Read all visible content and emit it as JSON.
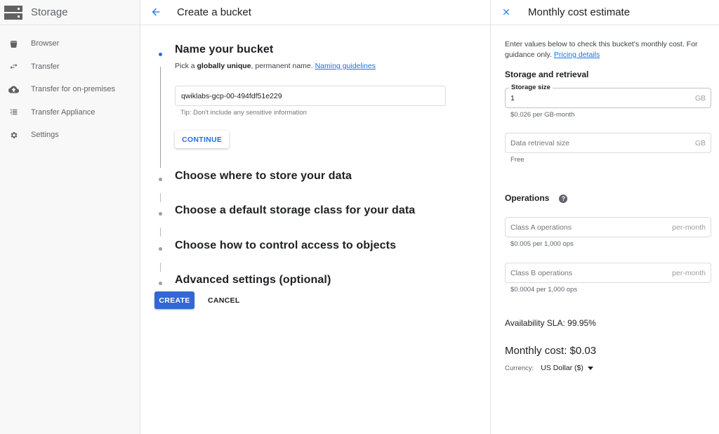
{
  "sidebar": {
    "title": "Storage",
    "items": [
      {
        "label": "Browser",
        "icon": "bucket-icon"
      },
      {
        "label": "Transfer",
        "icon": "transfer-arrows-icon"
      },
      {
        "label": "Transfer for on-premises",
        "icon": "cloud-upload-icon"
      },
      {
        "label": "Transfer Appliance",
        "icon": "appliance-list-icon"
      },
      {
        "label": "Settings",
        "icon": "gear-icon"
      }
    ]
  },
  "main": {
    "title": "Create a bucket",
    "steps": [
      {
        "title": "Name your bucket",
        "desc_prefix": "Pick a ",
        "desc_bold": "globally unique",
        "desc_suffix": ", permanent name. ",
        "link": "Naming guidelines",
        "input_value": "qwiklabs-gcp-00-494fdf51e229",
        "tip": "Tip: Don't include any sensitive information",
        "continue_label": "CONTINUE",
        "active": true
      },
      {
        "title": "Choose where to store your data"
      },
      {
        "title": "Choose a default storage class for your data"
      },
      {
        "title": "Choose how to control access to objects"
      },
      {
        "title": "Advanced settings (optional)"
      }
    ],
    "create_label": "CREATE",
    "cancel_label": "CANCEL"
  },
  "panel": {
    "title": "Monthly cost estimate",
    "intro": "Enter values below to check this bucket's monthly cost. For guidance only. ",
    "intro_link": "Pricing details",
    "storage_section": "Storage and retrieval",
    "storage_size": {
      "label": "Storage size",
      "value": "1",
      "unit": "GB",
      "hint": "$0.026 per GB-month"
    },
    "retrieval_size": {
      "placeholder": "Data retrieval size",
      "unit": "GB",
      "hint": "Free"
    },
    "operations_section": "Operations",
    "class_a": {
      "placeholder": "Class A operations",
      "unit": "per-month",
      "hint": "$0.005 per 1,000 ops"
    },
    "class_b": {
      "placeholder": "Class B operations",
      "unit": "per-month",
      "hint": "$0.0004 per 1,000 ops"
    },
    "sla": "Availability SLA: 99.95%",
    "monthly_cost": "Monthly cost: $0.03",
    "currency_label": "Currency:",
    "currency_value": "US Dollar ($)"
  },
  "colors": {
    "accent": "#1a73e8",
    "primary_button": "#3367d6"
  }
}
